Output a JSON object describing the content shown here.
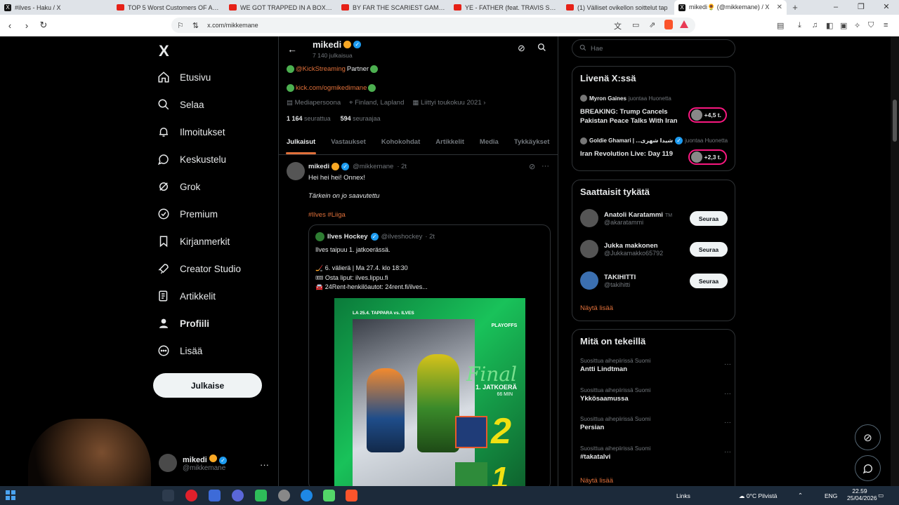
{
  "browser": {
    "tabs": [
      {
        "label": "#ilves - Haku / X",
        "icon": "x-logo"
      },
      {
        "label": "TOP 5 Worst Customers OF ALL TIME",
        "icon": "youtube"
      },
      {
        "label": "WE GOT TRAPPED IN A BOX FOR 24",
        "icon": "youtube"
      },
      {
        "label": "BY FAR THE SCARIEST GAME OF THE",
        "icon": "youtube"
      },
      {
        "label": "YE - FATHER (feat. TRAVIS SCOTT) - Y",
        "icon": "youtube"
      },
      {
        "label": "(1) Välliset ovikellon soittelut tap",
        "icon": "youtube"
      },
      {
        "label": "mikedi🌻 (@mikkemane) / X",
        "icon": "x-logo",
        "active": true
      }
    ],
    "url": "x.com/mikkemane",
    "new_tab": "+",
    "close": "✕"
  },
  "sidebar": {
    "logo": "X",
    "items": [
      {
        "label": "Etusivu",
        "icon": "home-icon"
      },
      {
        "label": "Selaa",
        "icon": "search-icon"
      },
      {
        "label": "Ilmoitukset",
        "icon": "bell-icon"
      },
      {
        "label": "Keskustelu",
        "icon": "chat-icon"
      },
      {
        "label": "Grok",
        "icon": "grok-icon"
      },
      {
        "label": "Premium",
        "icon": "premium-icon"
      },
      {
        "label": "Kirjanmerkit",
        "icon": "bookmark-icon"
      },
      {
        "label": "Creator Studio",
        "icon": "rocket-icon"
      },
      {
        "label": "Artikkelit",
        "icon": "article-icon"
      },
      {
        "label": "Profiili",
        "icon": "profile-icon"
      },
      {
        "label": "Lisää",
        "icon": "more-icon"
      }
    ],
    "post_button": "Julkaise",
    "account": {
      "name": "mikedi",
      "handle": "@mikkemane",
      "more": "···"
    }
  },
  "profile": {
    "name": "mikedi",
    "post_count": "7 140 julkaisua",
    "bio_line1_link": "@KickStreaming",
    "bio_line1_text": "Partner",
    "bio_line2_link": "kick.com/ogmikedimane",
    "meta_category": "Mediapersoona",
    "meta_location": "Finland, Lapland",
    "meta_joined": "Liittyi toukokuu 2021",
    "following_count": "1 164",
    "following_label": "seurattua",
    "followers_count": "594",
    "followers_label": "seuraajaa",
    "tabs": [
      "Julkaisut",
      "Vastaukset",
      "Kohokohdat",
      "Artikkelit",
      "Media",
      "Tykkäykset"
    ]
  },
  "post": {
    "name": "mikedi",
    "handle": "@mikkemane",
    "time": "· 2t",
    "line1": "Hei hei hei! Onnex!",
    "line2": "Tärkein on jo saavutettu",
    "hashtags": "#Ilves #Liiga",
    "quote": {
      "name": "Ilves Hockey",
      "handle": "@ilveshockey",
      "time": "· 2t",
      "line1": "Ilves taipuu 1. jatkoerässä.",
      "line2": "🏒 6. välierä | Ma 27.4. klo 18:30",
      "line3": "🎟 Osta liput: ilves.lippu.fi",
      "line4": "🚘 24Rent-henkilöautot: 24rent.fi/ilves...",
      "image": {
        "top_text": "LA 25.4. TAPPARA vs. ILVES",
        "badge": "PLAYOFFS",
        "final": "Final",
        "period": "1. JATKOERÄ",
        "minutes": "66 MIN",
        "score_home": "2",
        "score_away": "1"
      }
    }
  },
  "right": {
    "search_placeholder": "Hae",
    "live_title": "Livenä X:ssä",
    "live": [
      {
        "host": "Myron Gaines",
        "joins": "juontaa Huonetta",
        "title": "BREAKING: Trump Cancels Pakistan Peace Talks With Iran",
        "count": "+4,5 t."
      },
      {
        "host": "Goldie Ghamari | ...شیدا شهری",
        "joins": "juontaa Huonetta",
        "title": "Iran Revolution Live: Day 119",
        "count": "+2,3 t."
      }
    ],
    "suggest_title": "Saattaisit tykätä",
    "suggest": [
      {
        "name": "Anatoli Karatammi",
        "tag": "TM",
        "handle": "@akaratammi",
        "btn": "Seuraa"
      },
      {
        "name": "Jukka makkonen",
        "tag": "",
        "handle": "@Jukkamakko65792",
        "btn": "Seuraa"
      },
      {
        "name": "TAKIHITTI",
        "tag": "",
        "handle": "@takihitti",
        "btn": "Seuraa"
      }
    ],
    "show_more": "Näytä lisää",
    "trends_title": "Mitä on tekeillä",
    "trends": [
      {
        "context": "Suosittua aihepiirissä Suomi",
        "name": "Antti Lindtman"
      },
      {
        "context": "Suosittua aihepiirissä Suomi",
        "name": "Ykkösaamussa"
      },
      {
        "context": "Suosittua aihepiirissä Suomi",
        "name": "Persian"
      },
      {
        "context": "Suosittua aihepiirissä Suomi",
        "name": "#takatalvi"
      }
    ],
    "trends_more": "Näytä lisää"
  },
  "taskbar": {
    "links": "Links",
    "weather": "0°C Pilvistä",
    "lang": "ENG",
    "time": "22.59",
    "date": "25/04/2026"
  },
  "colors": {
    "accent": "#e0703a",
    "live": "#f91880",
    "verified": "#1d9bf0"
  }
}
